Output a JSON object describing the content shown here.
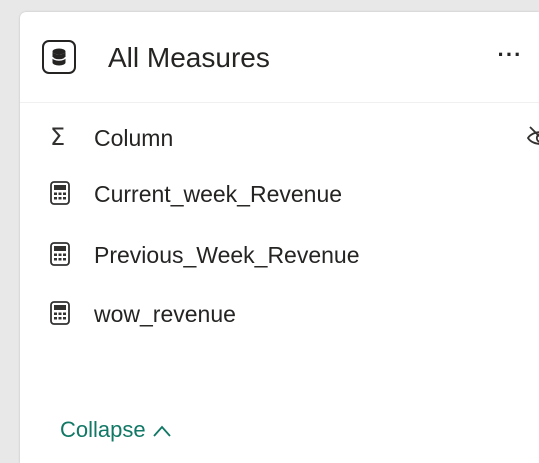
{
  "card": {
    "title": "All Measures",
    "more_label": "···",
    "table_icon": "database-icon",
    "fields": [
      {
        "label": "Column",
        "icon": "sigma-icon",
        "hidden": true
      },
      {
        "label": "Current_week_Revenue",
        "icon": "calculator-icon",
        "hidden": false
      },
      {
        "label": "Previous_Week_Revenue",
        "icon": "calculator-icon",
        "hidden": false
      },
      {
        "label": "wow_revenue",
        "icon": "calculator-icon",
        "hidden": false
      }
    ],
    "collapse_label": "Collapse",
    "accent_color": "#117865",
    "text_color": "#252423"
  }
}
